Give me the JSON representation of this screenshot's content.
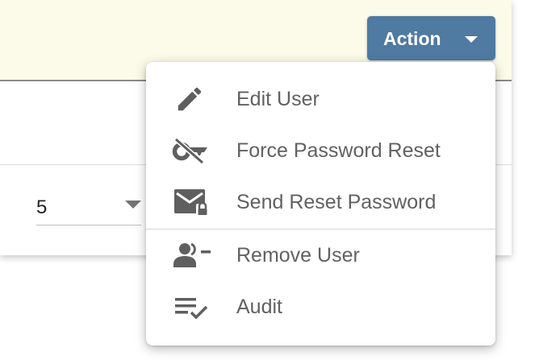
{
  "colors": {
    "banner_bg": "#fcfae8",
    "action_button_bg": "#4f7aa1",
    "menu_text": "#616161",
    "icon": "#5f5f5f"
  },
  "action_button": {
    "label": "Action",
    "icon": "caret-down-icon"
  },
  "page_size_select": {
    "value": "5",
    "icon": "caret-down-icon"
  },
  "menu": {
    "items": [
      {
        "label": "Edit User",
        "icon": "pencil-icon"
      },
      {
        "label": "Force Password Reset",
        "icon": "key-off-icon"
      },
      {
        "label": "Send Reset Password",
        "icon": "email-lock-icon"
      },
      {
        "label": "Remove User",
        "icon": "account-remove-icon"
      },
      {
        "label": "Audit",
        "icon": "playlist-check-icon"
      }
    ]
  }
}
